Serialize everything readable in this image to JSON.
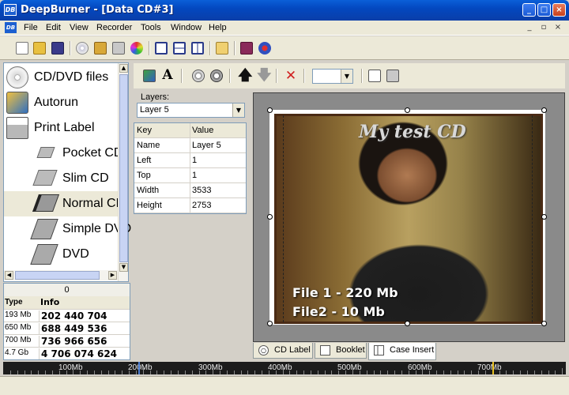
{
  "window": {
    "app_icon": "DB",
    "title": "DeepBurner - [Data CD#3]",
    "controls": {
      "minimize": "_",
      "maximize": "□",
      "close": "×"
    }
  },
  "menu": {
    "items": [
      "File",
      "Edit",
      "View",
      "Recorder",
      "Tools",
      "Window",
      "Help"
    ],
    "mdi": {
      "minimize": "_",
      "restore": "▫",
      "close": "×"
    }
  },
  "toolbar": {
    "icons": [
      "new-file-icon",
      "open-folder-icon",
      "save-icon",
      "disc-icon",
      "image-icon",
      "print-icon",
      "color-disc-icon",
      "cascade-icon",
      "tile-horizontal-icon",
      "tile-vertical-icon",
      "folder-icon",
      "book-icon",
      "help-icon"
    ]
  },
  "nav": {
    "items": [
      {
        "label": "CD/DVD files",
        "icon": "cd-icon"
      },
      {
        "label": "Autorun",
        "icon": "autorun-icon"
      },
      {
        "label": "Print Label",
        "icon": "printer-icon"
      },
      {
        "label": "Pocket CD",
        "icon": "pocket-cd-icon"
      },
      {
        "label": "Slim CD",
        "icon": "slim-cd-icon"
      },
      {
        "label": "Normal CD",
        "icon": "normal-cd-icon"
      },
      {
        "label": "Simple DVD",
        "icon": "simple-dvd-icon"
      },
      {
        "label": "DVD",
        "icon": "dvd-icon"
      }
    ]
  },
  "disc_info": {
    "header": "0",
    "columns": {
      "type": "Type",
      "info": "Info"
    },
    "rows": [
      {
        "type": "193 Mb",
        "info": "202 440 704"
      },
      {
        "type": "650 Mb",
        "info": "688 449 536"
      },
      {
        "type": "700 Mb",
        "info": "736 966 656"
      },
      {
        "type": "4.7 Gb",
        "info": "4 706 074 624"
      }
    ]
  },
  "properties": {
    "layers_label": "Layers:",
    "layer_selected": "Layer 5",
    "columns": {
      "key": "Key",
      "value": "Value"
    },
    "rows": [
      {
        "key": "Name",
        "value": "Layer 5"
      },
      {
        "key": "Left",
        "value": "1"
      },
      {
        "key": "Top",
        "value": "1"
      },
      {
        "key": "Width",
        "value": "3533"
      },
      {
        "key": "Height",
        "value": "2753"
      }
    ]
  },
  "label_canvas": {
    "title": "My test CD",
    "line1": "File 1 - 220 Mb",
    "line2": "File2 - 10 Mb"
  },
  "tabs": [
    {
      "label": "CD Label",
      "icon": "cd-label-icon"
    },
    {
      "label": "Booklet",
      "icon": "booklet-icon"
    },
    {
      "label": "Case Insert",
      "icon": "case-insert-icon",
      "active": true
    }
  ],
  "ruler": {
    "labels": [
      "100Mb",
      "200Mb",
      "300Mb",
      "400Mb",
      "500Mb",
      "600Mb",
      "700Mb"
    ],
    "used_mb": 193,
    "marker_colors": {
      "used": "#4a7cd0",
      "cd_limit": "#e8c020"
    }
  },
  "colors": {
    "title_bar": "#0348c0",
    "chrome": "#ece9d8",
    "canvas_bg": "#8a8a8a"
  }
}
